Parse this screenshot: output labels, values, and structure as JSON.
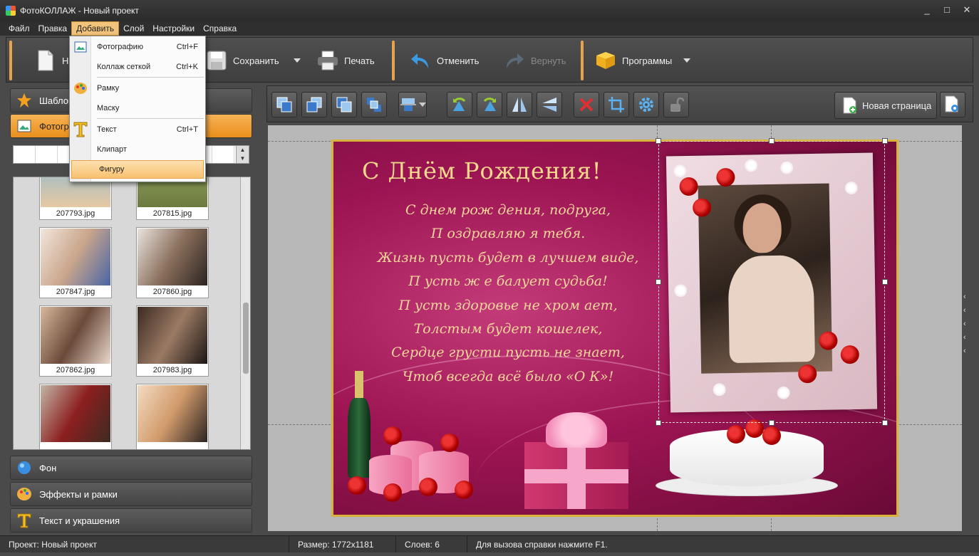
{
  "window": {
    "title": "ФотоКОЛЛАЖ - Новый проект",
    "controls": [
      "_",
      "□",
      "✕"
    ]
  },
  "menubar": {
    "items": [
      "Файл",
      "Правка",
      "Добавить",
      "Слой",
      "Настройки",
      "Справка"
    ],
    "active_index": 2
  },
  "toolbar": {
    "new_label": "Но",
    "save_label": "Сохранить",
    "print_label": "Печать",
    "undo_label": "Отменить",
    "redo_label": "Вернуть",
    "programs_label": "Программы"
  },
  "add_menu": {
    "items": [
      {
        "label": "Фотографию",
        "shortcut": "Ctrl+F",
        "icon": "photo-icon"
      },
      {
        "label": "Коллаж сеткой",
        "shortcut": "Ctrl+K",
        "icon": ""
      },
      {
        "label": "Рамку",
        "shortcut": "",
        "icon": "palette-icon"
      },
      {
        "label": "Маску",
        "shortcut": "",
        "icon": ""
      },
      {
        "label": "Текст",
        "shortcut": "Ctrl+T",
        "icon": "text-icon"
      },
      {
        "label": "Клипарт",
        "shortcut": "",
        "icon": ""
      },
      {
        "label": "Фигуру",
        "shortcut": "",
        "icon": ""
      }
    ],
    "highlighted_index": 6
  },
  "left_panel": {
    "sections": {
      "templates": "Шаблоны",
      "photos": "Фотогра",
      "background": "Фон",
      "effects": "Эффекты и рамки",
      "text": "Текст и украшения"
    },
    "thumbnails": [
      {
        "name": "207793.jpg"
      },
      {
        "name": "207815.jpg"
      },
      {
        "name": "207847.jpg"
      },
      {
        "name": "207860.jpg"
      },
      {
        "name": "207862.jpg"
      },
      {
        "name": "207983.jpg"
      },
      {
        "name": ""
      },
      {
        "name": ""
      }
    ]
  },
  "edit_toolbar": {
    "new_page_label": "Новая страница",
    "tools": [
      "bring-front-icon",
      "bring-forward-icon",
      "send-backward-icon",
      "send-back-icon",
      "align-icon",
      "rotate-left-icon",
      "rotate-right-icon",
      "flip-horizontal-icon",
      "flip-vertical-icon",
      "delete-icon",
      "crop-icon",
      "settings-icon",
      "lock-icon"
    ]
  },
  "card": {
    "heading": "С Днём Рождения!",
    "poem": [
      "С днем  рож дения, подруга,",
      "П оздравляю я тебя.",
      "Жизнь пусть будет  в  лучшем  виде,",
      "П усть ж е балует  судьба!",
      "П усть здоровье не хром ает,",
      "Толстым  будет  кошелек,",
      "Сердце грусти пусть не знает,",
      "Чтоб всегда всё было «О К»!"
    ]
  },
  "statusbar": {
    "project": "Проект: Новый проект",
    "size": "Размер: 1772x1181",
    "layers": "Слоев: 6",
    "hint": "Для вызова справки нажмите F1."
  },
  "colors": {
    "accent": "#f0a040",
    "card_bg": "#9e1554",
    "gold": "#d8b23a"
  }
}
